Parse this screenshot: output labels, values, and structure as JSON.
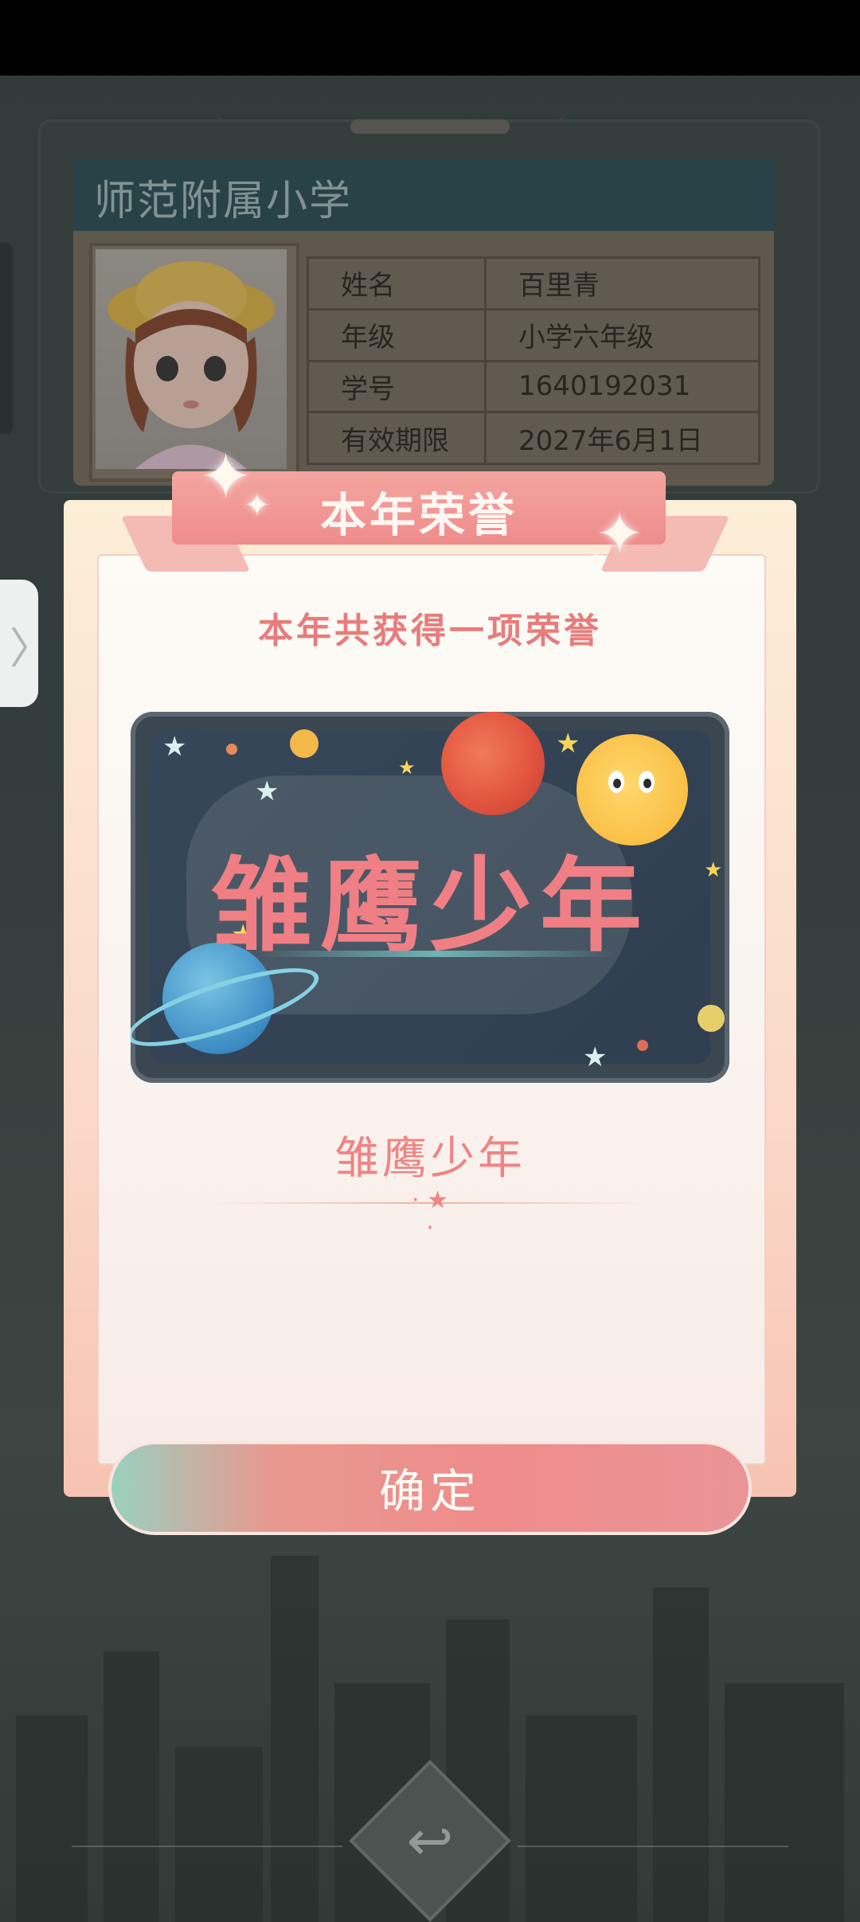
{
  "id_card": {
    "school_name": "师范附属小学",
    "fields": [
      {
        "label": "姓名",
        "value": "百里青"
      },
      {
        "label": "年级",
        "value": "小学六年级"
      },
      {
        "label": "学号",
        "value": "1640192031"
      },
      {
        "label": "有效期限",
        "value": "2027年6月1日"
      }
    ]
  },
  "dialog": {
    "title": "本年荣誉",
    "subtitle": "本年共获得一项荣誉",
    "badge": {
      "card_text": "雏鹰少年",
      "name": "雏鹰少年"
    },
    "confirm_label": "确定"
  },
  "side_tab": {
    "glyph": "〉"
  },
  "icons": {
    "back": "return-arrow-icon",
    "side": "chevron-right-icon",
    "sparkle": "sparkle-icon",
    "star": "star-icon"
  },
  "colors": {
    "accent": "#ef8484",
    "ribbon": "#ee8c8c",
    "badge_bg": "#3a4650",
    "school_header": "#2f5258"
  }
}
